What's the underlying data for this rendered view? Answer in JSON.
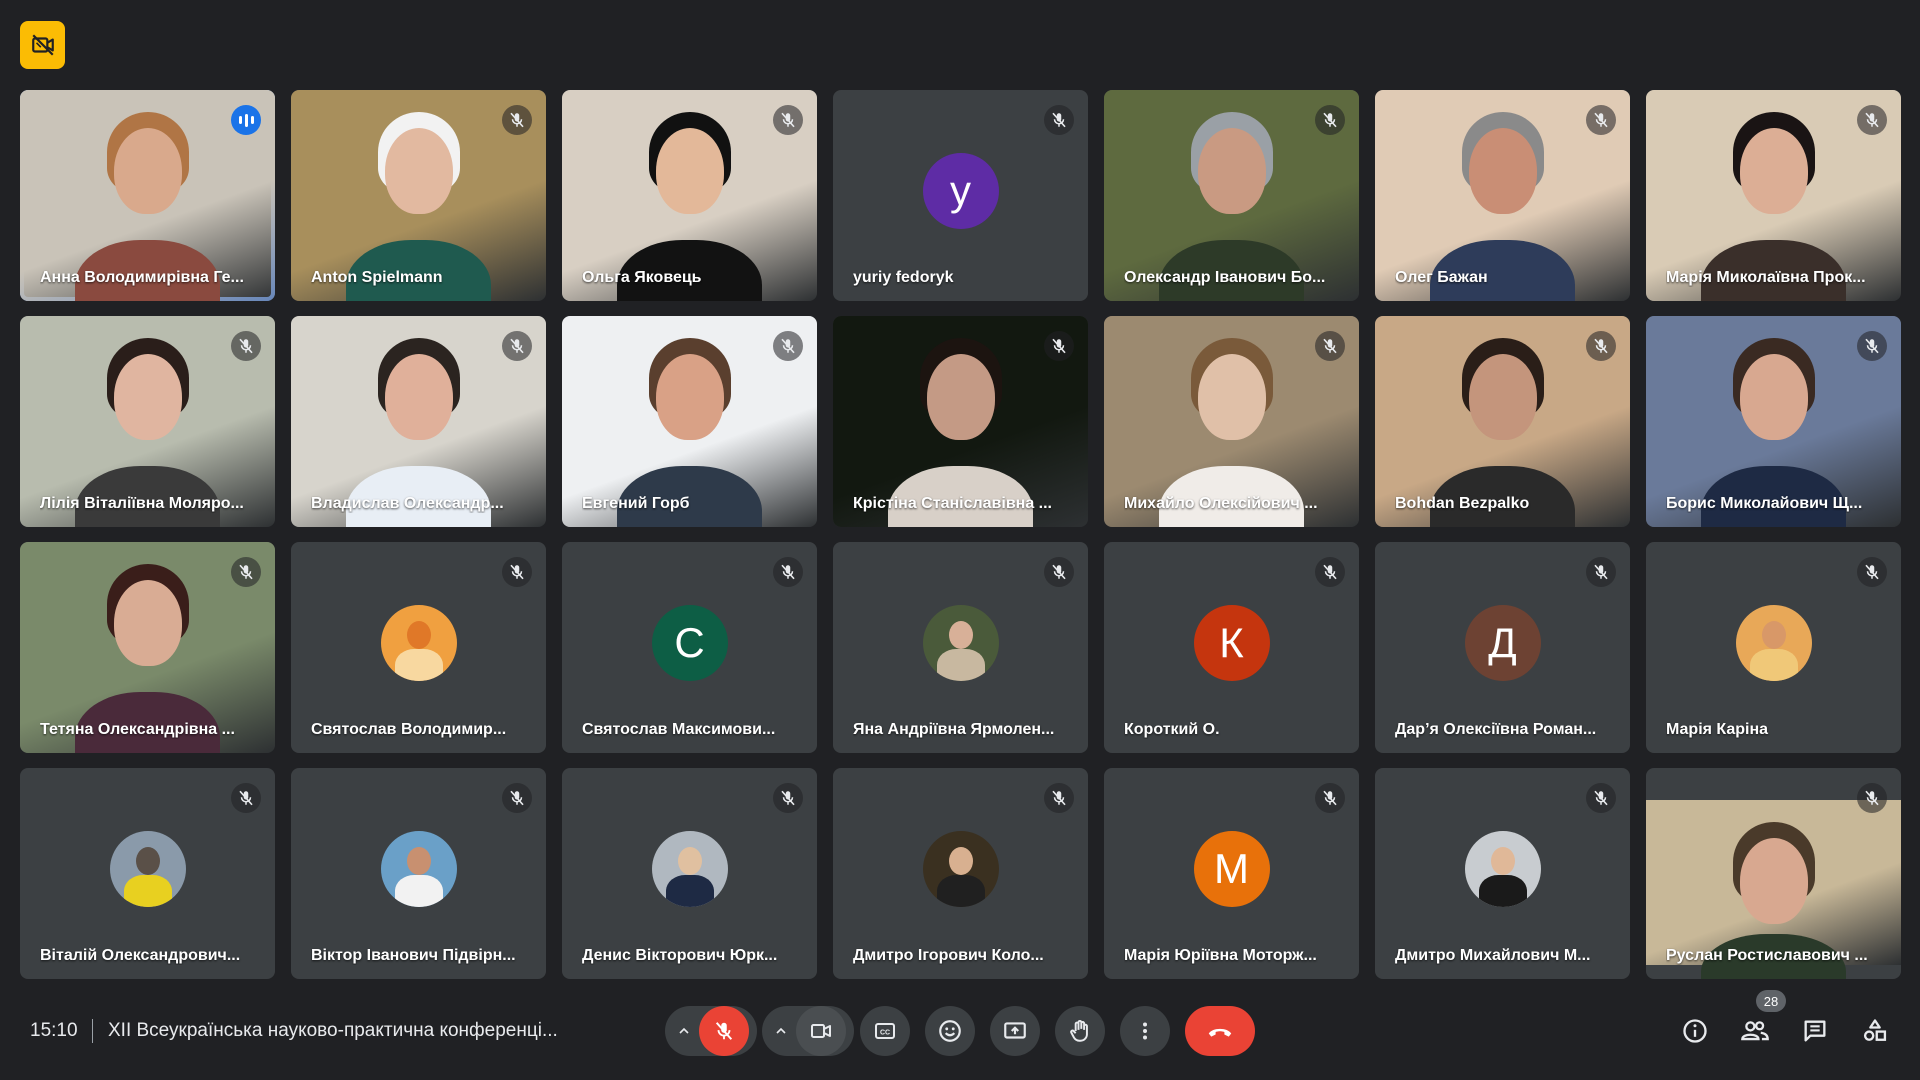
{
  "colors": {
    "background": "#202124",
    "tile": "#3c4043",
    "active_border": "#8ab4f8",
    "mic_off_red": "#ea4335",
    "end_call_red": "#ea4335",
    "speaking_blue": "#1a73e8",
    "recording_yellow": "#fbbc04"
  },
  "recording_icon": "no-camera-recording-icon",
  "participants": [
    {
      "name": "Анна Володимирівна Ге...",
      "type": "video",
      "active": true,
      "speaking": true,
      "colors": {
        "bg": "#c9c3b8",
        "skin": "#d9a98c",
        "hair": "#b07545",
        "body": "#8a4a3f"
      }
    },
    {
      "name": "Anton Spielmann",
      "type": "video",
      "colors": {
        "bg": "#a88f5c",
        "skin": "#e2b9a0",
        "hair": "#f2f2f2",
        "body": "#1f5a4f"
      }
    },
    {
      "name": "Ольга Яковець",
      "type": "video",
      "colors": {
        "bg": "#d8cfc3",
        "skin": "#e3b899",
        "hair": "#111111",
        "body": "#121212"
      }
    },
    {
      "name": "yuriy fedoryk",
      "type": "avatar",
      "initial": "y",
      "colors": {
        "bg": "#5e2ca5"
      }
    },
    {
      "name": "Олександр Іванович Бо...",
      "type": "video",
      "colors": {
        "bg": "#5e6a3f",
        "skin": "#c99a82",
        "hair": "#9aa0a6",
        "body": "#2d3a28"
      }
    },
    {
      "name": "Олег Бажан",
      "type": "video",
      "colors": {
        "bg": "#e0cbb5",
        "skin": "#c98e75",
        "hair": "#8a8a8a",
        "body": "#2e3c5a"
      }
    },
    {
      "name": "Марія Миколаївна Прок...",
      "type": "video",
      "colors": {
        "bg": "#d9cbb5",
        "skin": "#dcae95",
        "hair": "#1a1414",
        "body": "#3a2f2a"
      }
    },
    {
      "name": "Лілія Віталіївна Моляро...",
      "type": "video",
      "colors": {
        "bg": "#b8bcae",
        "skin": "#e0b5a0",
        "hair": "#2a1e1a",
        "body": "#3a3a3a"
      }
    },
    {
      "name": "Владислав Олександр...",
      "type": "video",
      "colors": {
        "bg": "#d7d4cc",
        "skin": "#e0b09a",
        "hair": "#2b2420",
        "body": "#e8eef5"
      }
    },
    {
      "name": "Евгений Горб",
      "type": "video",
      "colors": {
        "bg": "#eef0f2",
        "skin": "#d9a186",
        "hair": "#5a3f2e",
        "body": "#2e3a4a"
      }
    },
    {
      "name": "Крістіна Станіславівна ...",
      "type": "video",
      "colors": {
        "bg": "#121810",
        "skin": "#c49a85",
        "hair": "#1c1410",
        "body": "#d8d0c8"
      }
    },
    {
      "name": "Михайло Олексійович ...",
      "type": "video",
      "colors": {
        "bg": "#9c8a70",
        "skin": "#e0c0a8",
        "hair": "#7a5a3a",
        "body": "#f0ece8"
      }
    },
    {
      "name": "Bohdan Bezpalko",
      "type": "video",
      "colors": {
        "bg": "#c8a886",
        "skin": "#c4957c",
        "hair": "#2a1e18",
        "body": "#2a2a2a"
      }
    },
    {
      "name": "Борис Миколайович Щ...",
      "type": "video",
      "colors": {
        "bg": "#6a7a9a",
        "skin": "#d8a890",
        "hair": "#3a2a22",
        "body": "#1e2a44"
      }
    },
    {
      "name": "Тетяна Олександрівна ...",
      "type": "video",
      "colors": {
        "bg": "#7a8a6a",
        "skin": "#d9ac94",
        "hair": "#3a1e1a",
        "body": "#4a2a3a"
      }
    },
    {
      "name": "Святослав Володимир...",
      "type": "photo-avatar",
      "colors": {
        "bg": "#f0a040",
        "head": "#e07828",
        "body": "#f8d8a0"
      }
    },
    {
      "name": "Святослав Максимови...",
      "type": "avatar",
      "initial": "С",
      "colors": {
        "bg": "#0d5e45"
      }
    },
    {
      "name": "Яна Андріївна Ярмолен...",
      "type": "photo-avatar",
      "colors": {
        "bg": "#4a5a3a",
        "head": "#d8b098",
        "body": "#c8b8a0"
      }
    },
    {
      "name": "Короткий О.",
      "type": "avatar",
      "initial": "К",
      "colors": {
        "bg": "#c5350e"
      }
    },
    {
      "name": "Дар’я Олексіївна Роман...",
      "type": "avatar",
      "initial": "Д",
      "colors": {
        "bg": "#6d4233"
      }
    },
    {
      "name": "Марія Каріна",
      "type": "photo-avatar",
      "colors": {
        "bg": "#e8a858",
        "head": "#d89868",
        "body": "#f0c878"
      }
    },
    {
      "name": "Віталій Олександрович...",
      "type": "photo-avatar",
      "colors": {
        "bg": "#8a9aaa",
        "head": "#5a5048",
        "body": "#e8d020"
      }
    },
    {
      "name": "Віктор Іванович Підвірн...",
      "type": "photo-avatar",
      "colors": {
        "bg": "#6aa0c8",
        "head": "#c89070",
        "body": "#f2f2f2"
      }
    },
    {
      "name": "Денис Вікторович Юрк...",
      "type": "photo-avatar",
      "colors": {
        "bg": "#b0b8c0",
        "head": "#e0c0a0",
        "body": "#1e2a44"
      }
    },
    {
      "name": "Дмитро Ігорович Коло...",
      "type": "photo-avatar",
      "colors": {
        "bg": "#3a3020",
        "head": "#d8b090",
        "body": "#202020"
      }
    },
    {
      "name": "Марія Юріївна Моторж...",
      "type": "avatar",
      "initial": "М",
      "colors": {
        "bg": "#e8710a"
      }
    },
    {
      "name": "Дмитро Михайлович М...",
      "type": "photo-avatar",
      "colors": {
        "bg": "#c8ccd0",
        "head": "#e0b898",
        "body": "#1a1a1a"
      }
    },
    {
      "name": "Руслан Ростиславович ...",
      "type": "video-inset",
      "colors": {
        "bg": "#c8b898",
        "skin": "#d8a890",
        "hair": "#4a3a2a",
        "body": "#2a3a2a"
      }
    }
  ],
  "bottom_bar": {
    "time": "15:10",
    "meeting_title": "XII Всеукраїнська науково-практична конференці...",
    "participant_count": "28",
    "controls": [
      {
        "name": "mic-options",
        "icon": "chevron-up-icon"
      },
      {
        "name": "mic-toggle",
        "icon": "mic-off-icon",
        "state": "off"
      },
      {
        "name": "camera-options",
        "icon": "chevron-up-icon"
      },
      {
        "name": "camera-toggle",
        "icon": "videocam-icon"
      },
      {
        "name": "captions",
        "icon": "closed-captions-icon"
      },
      {
        "name": "reactions",
        "icon": "emoji-icon"
      },
      {
        "name": "present",
        "icon": "present-screen-icon"
      },
      {
        "name": "raise-hand",
        "icon": "hand-icon"
      },
      {
        "name": "more-options",
        "icon": "more-vert-icon"
      },
      {
        "name": "leave-call",
        "icon": "call-end-icon"
      }
    ],
    "right_icons": [
      "info-icon",
      "people-icon",
      "chat-icon",
      "activities-icon"
    ]
  }
}
